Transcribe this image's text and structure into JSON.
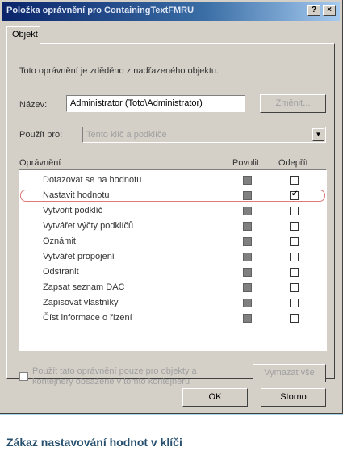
{
  "window": {
    "title": "Položka oprávnění pro ContainingTextFMRU",
    "help_btn": "?",
    "close_btn": "×"
  },
  "tab": {
    "label": "Objekt"
  },
  "inherit_note": "Toto oprávnění je zděděno z nadřazeného objektu.",
  "name_row": {
    "label": "Název:",
    "value": "Administrator (Toto\\Administrator)",
    "change_btn": "Změnit..."
  },
  "apply_row": {
    "label": "Použít pro:",
    "value": "Tento klíč a podklíče"
  },
  "headers": {
    "permission": "Oprávnění",
    "allow": "Povolit",
    "deny": "Odepřít"
  },
  "permissions": [
    {
      "label": "Dotazovat se na hodnotu",
      "allow": true,
      "deny": false,
      "highlighted": false
    },
    {
      "label": "Nastavit hodnotu",
      "allow": true,
      "deny": true,
      "highlighted": true
    },
    {
      "label": "Vytvořit podklíč",
      "allow": true,
      "deny": false,
      "highlighted": false
    },
    {
      "label": "Vytvářet výčty podklíčů",
      "allow": true,
      "deny": false,
      "highlighted": false
    },
    {
      "label": "Oznámit",
      "allow": true,
      "deny": false,
      "highlighted": false
    },
    {
      "label": "Vytvářet propojení",
      "allow": true,
      "deny": false,
      "highlighted": false
    },
    {
      "label": "Odstranit",
      "allow": true,
      "deny": false,
      "highlighted": false
    },
    {
      "label": "Zapsat seznam DAC",
      "allow": true,
      "deny": false,
      "highlighted": false
    },
    {
      "label": "Zapisovat vlastníky",
      "allow": true,
      "deny": false,
      "highlighted": false
    },
    {
      "label": "Číst informace o řízení",
      "allow": true,
      "deny": false,
      "highlighted": false
    }
  ],
  "inherit_checkbox": {
    "label": "Použít tato oprávnění pouze pro objekty a kontejnery obsažené v tomto kontejneru",
    "checked": false
  },
  "clear_all_btn": "Vymazat vše",
  "ok_btn": "OK",
  "cancel_btn": "Storno",
  "caption": "Zákaz nastavování hodnot v klíči"
}
